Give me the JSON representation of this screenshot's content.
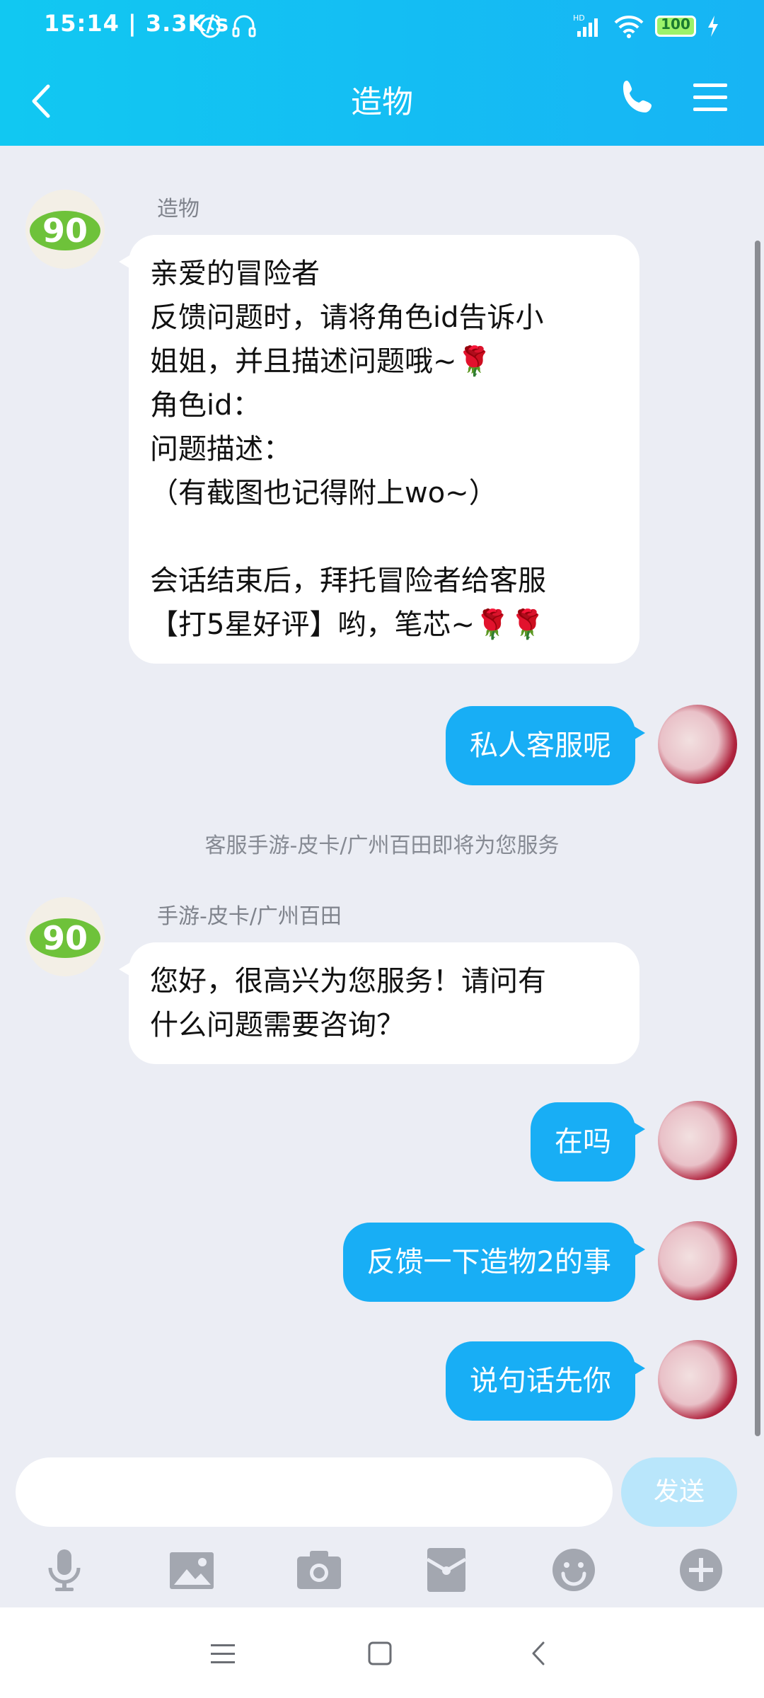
{
  "status": {
    "time": "15:14",
    "speed": "3.3K/s",
    "battery": "100"
  },
  "header": {
    "title": "造物"
  },
  "messages": {
    "m1": {
      "sender": "造物",
      "lines": [
        "亲爱的冒险者",
        "反馈问题时，请将角色id告诉小",
        "姐姐，并且描述问题哦~🌹",
        "角色id：",
        "问题描述：",
        "（有截图也记得附上wo~）",
        "",
        "会话结束后，拜托冒险者给客服",
        "【打5星好评】哟，笔芯~🌹🌹"
      ]
    },
    "m2": {
      "text": "私人客服呢"
    },
    "system": {
      "text": "客服手游-皮卡/广州百田即将为您服务"
    },
    "m3": {
      "sender": "手游-皮卡/广州百田",
      "lines": [
        "您好，很高兴为您服务！请问有",
        "什么问题需要咨询？"
      ]
    },
    "m4": {
      "text": "在吗"
    },
    "m5": {
      "text": "反馈一下造物2的事"
    },
    "m6": {
      "text": "说句话先你"
    }
  },
  "input": {
    "value": "",
    "send_label": "发送"
  },
  "colors": {
    "accent": "#18aef5",
    "background": "#ebedf4",
    "send_disabled": "#b9e6fb"
  },
  "icons": {
    "toolbar": [
      "mic-icon",
      "image-icon",
      "camera-icon",
      "redpacket-icon",
      "emoji-icon",
      "plus-icon"
    ],
    "nav": [
      "menu-icon",
      "home-icon",
      "back-icon"
    ]
  }
}
